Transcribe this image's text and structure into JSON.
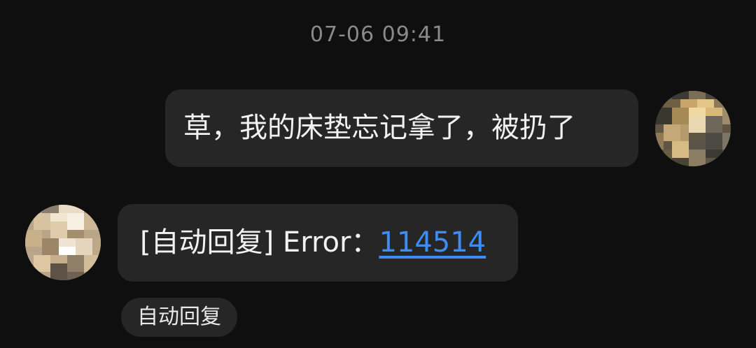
{
  "chat": {
    "timestamp": "07-06 09:41",
    "outgoing_message": "草，我的床垫忘记拿了，被扔了",
    "incoming_message": {
      "prefix": "[自动回复] Error：",
      "link_text": "114514"
    },
    "auto_reply_chip": "自动回复"
  },
  "avatars": {
    "self": "pixelated-avatar-icon",
    "peer": "pixelated-avatar-icon"
  },
  "colors": {
    "background": "#0f0f0f",
    "bubble": "#262626",
    "link": "#3d8df5",
    "timestamp": "#8a8a8a"
  }
}
